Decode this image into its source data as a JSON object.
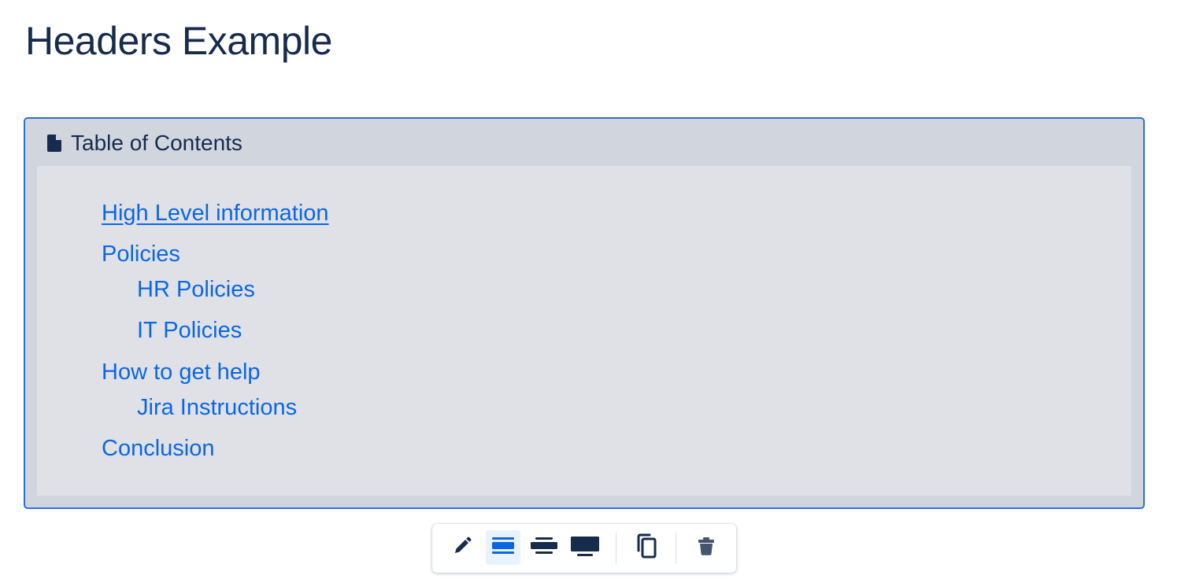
{
  "page": {
    "title": "Headers Example"
  },
  "toc_macro": {
    "title": "Table of Contents",
    "icon": "document-icon",
    "items": [
      {
        "label": "High Level information",
        "level": 1
      },
      {
        "label": "Policies",
        "level": 1
      },
      {
        "label": "HR Policies",
        "level": 2
      },
      {
        "label": "IT Policies",
        "level": 2
      },
      {
        "label": "How to get help",
        "level": 1
      },
      {
        "label": "Jira Instructions",
        "level": 2
      },
      {
        "label": "Conclusion",
        "level": 1
      }
    ]
  },
  "toolbar": {
    "buttons": [
      {
        "icon": "pencil-icon",
        "action": "edit"
      },
      {
        "icon": "layout-center-icon",
        "action": "center",
        "active": true
      },
      {
        "icon": "layout-wide-icon",
        "action": "wide"
      },
      {
        "icon": "layout-full-width-icon",
        "action": "full-width"
      },
      {
        "icon": "copy-icon",
        "action": "copy"
      },
      {
        "icon": "trash-icon",
        "action": "delete"
      }
    ]
  },
  "colors": {
    "link": "#0c66e4",
    "macro_border": "#2f6fe0",
    "macro_header_bg": "#d1d6de",
    "macro_body_bg": "#dfe1e6",
    "active_button_bg": "#e9f2ff",
    "text": "#172b4d"
  }
}
